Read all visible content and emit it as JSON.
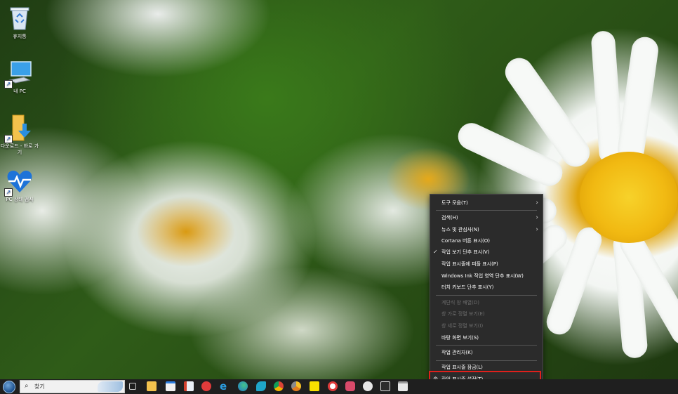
{
  "desktop": {
    "icons": [
      {
        "label": "휴지통",
        "icon": "recycle-bin-icon"
      },
      {
        "label": "내 PC",
        "icon": "computer-icon"
      },
      {
        "label": "다운로드 - 바로 가기",
        "icon": "download-folder-icon"
      },
      {
        "label": "PC 상태 검사",
        "icon": "pc-health-icon"
      }
    ]
  },
  "context_menu": {
    "items": [
      {
        "label": "도구 모음(T)",
        "submenu": true,
        "enabled": true
      },
      {
        "label": "검색(H)",
        "submenu": true,
        "enabled": true
      },
      {
        "label": "뉴스 및 관심사(N)",
        "submenu": true,
        "enabled": true
      },
      {
        "label": "Cortana 버튼 표시(O)",
        "enabled": true
      },
      {
        "label": "작업 보기 단추 표시(V)",
        "checked": true,
        "enabled": true
      },
      {
        "label": "작업 표시줄에 피플 표시(P)",
        "enabled": true
      },
      {
        "label": "Windows Ink 작업 영역 단추 표시(W)",
        "enabled": true
      },
      {
        "label": "터치 키보드 단추 표시(Y)",
        "enabled": true
      },
      {
        "label": "계단식 창 배열(D)",
        "enabled": false
      },
      {
        "label": "창 가로 정렬 보기(E)",
        "enabled": false
      },
      {
        "label": "창 세로 정렬 보기(I)",
        "enabled": false
      },
      {
        "label": "바탕 화면 보기(S)",
        "enabled": true
      },
      {
        "label": "작업 관리자(K)",
        "enabled": true
      },
      {
        "label": "작업 표시줄 잠금(L)",
        "enabled": true
      },
      {
        "label": "작업 표시줄 설정(T)",
        "enabled": true,
        "icon": "gear-icon"
      }
    ],
    "highlight_color": "#e0201c"
  },
  "taskbar": {
    "search_placeholder": "찾기",
    "pinned_icons": [
      "task-view-icon",
      "file-explorer-icon",
      "store-icon",
      "photos-icon",
      "app-red-icon",
      "ie-icon",
      "edge-icon",
      "bird-app-icon",
      "chrome-icon",
      "chrome-canary-icon",
      "kakaotalk-icon",
      "app-red-circle-icon",
      "network-app-icon",
      "app-hand-icon",
      "app-window-icon"
    ]
  }
}
